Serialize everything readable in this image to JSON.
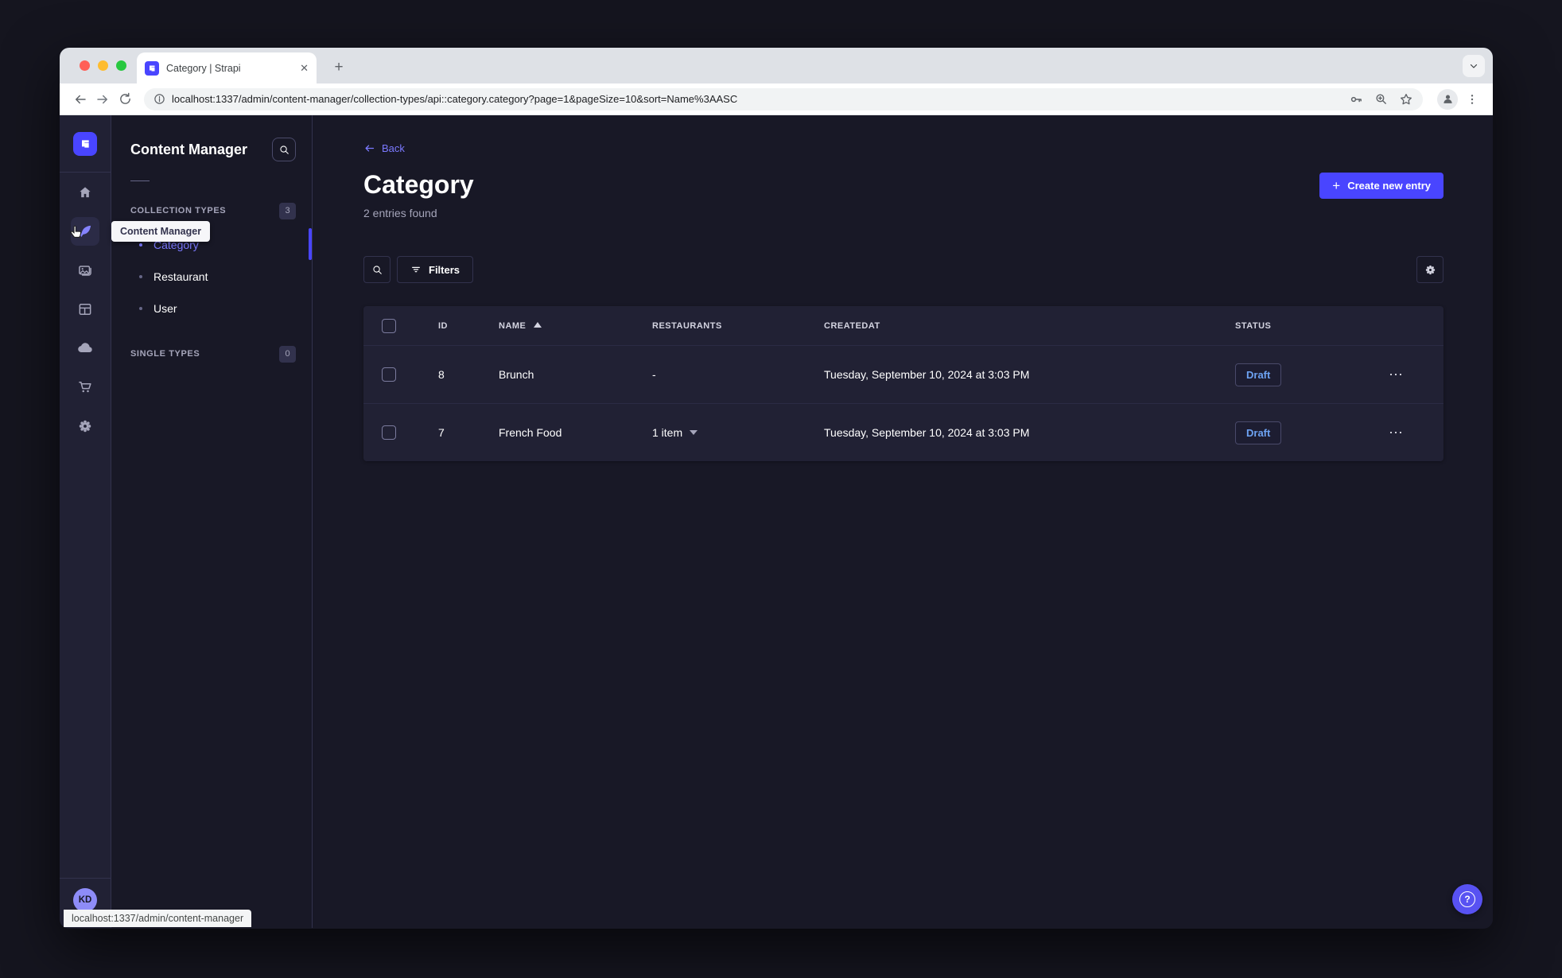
{
  "window": {
    "tab_title": "Category | Strapi",
    "url": "localhost:1337/admin/content-manager/collection-types/api::category.category?page=1&pageSize=10&sort=Name%3AASC",
    "status_link": "localhost:1337/admin/content-manager"
  },
  "sidebar": {
    "tooltip": "Content Manager",
    "avatar_initials": "KD",
    "icons": [
      "strapi-logo",
      "home",
      "content-manager",
      "media-library",
      "content-type-builder",
      "cloud",
      "marketplace",
      "settings"
    ]
  },
  "subnav": {
    "title": "Content Manager",
    "collection_types": {
      "label": "COLLECTION TYPES",
      "badge": "3",
      "items": [
        {
          "label": "Category",
          "active": true
        },
        {
          "label": "Restaurant",
          "active": false
        },
        {
          "label": "User",
          "active": false
        }
      ]
    },
    "single_types": {
      "label": "SINGLE TYPES",
      "badge": "0"
    }
  },
  "main": {
    "back": "Back",
    "title": "Category",
    "entries_count": "2 entries found",
    "create_button": "Create new entry",
    "filters_button": "Filters",
    "table": {
      "columns": {
        "id": "ID",
        "name": "NAME",
        "restaurants": "RESTAURANTS",
        "createdat": "CREATEDAT",
        "status": "STATUS"
      },
      "rows": [
        {
          "id": "8",
          "name": "Brunch",
          "restaurants": "-",
          "createdat": "Tuesday, September 10, 2024 at 3:03 PM",
          "status": "Draft"
        },
        {
          "id": "7",
          "name": "French Food",
          "restaurants": "1 item",
          "createdat": "Tuesday, September 10, 2024 at 3:03 PM",
          "status": "Draft"
        }
      ]
    }
  },
  "colors": {
    "primary": "#4945ff",
    "accent": "#7b79ff",
    "draft_text": "#6da3f3",
    "surface": "#212134",
    "background": "#181826"
  }
}
